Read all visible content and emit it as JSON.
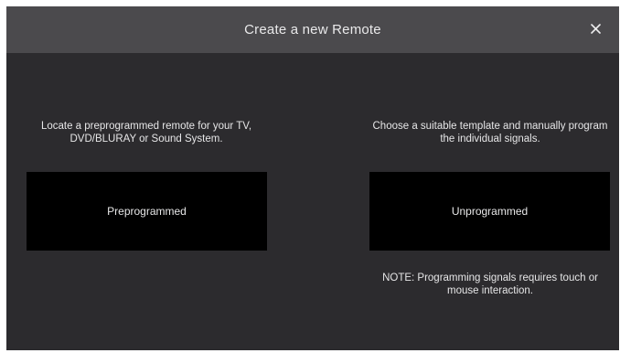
{
  "dialog": {
    "title": "Create a new Remote",
    "close_label": "×"
  },
  "preprogrammed": {
    "description": "Locate a preprogrammed remote for your TV, DVD/BLURAY or Sound System.",
    "button_label": "Preprogrammed"
  },
  "unprogrammed": {
    "description": "Choose a suitable template and manually program the individual signals.",
    "button_label": "Unprogrammed",
    "note": "NOTE: Programming signals requires touch or mouse interaction."
  },
  "colors": {
    "dialog_background": "#2c2b2e",
    "header_background": "#4b4a4d",
    "button_background": "#000000",
    "text": "#e6e6e7"
  },
  "icons": {
    "close": "close-icon"
  }
}
